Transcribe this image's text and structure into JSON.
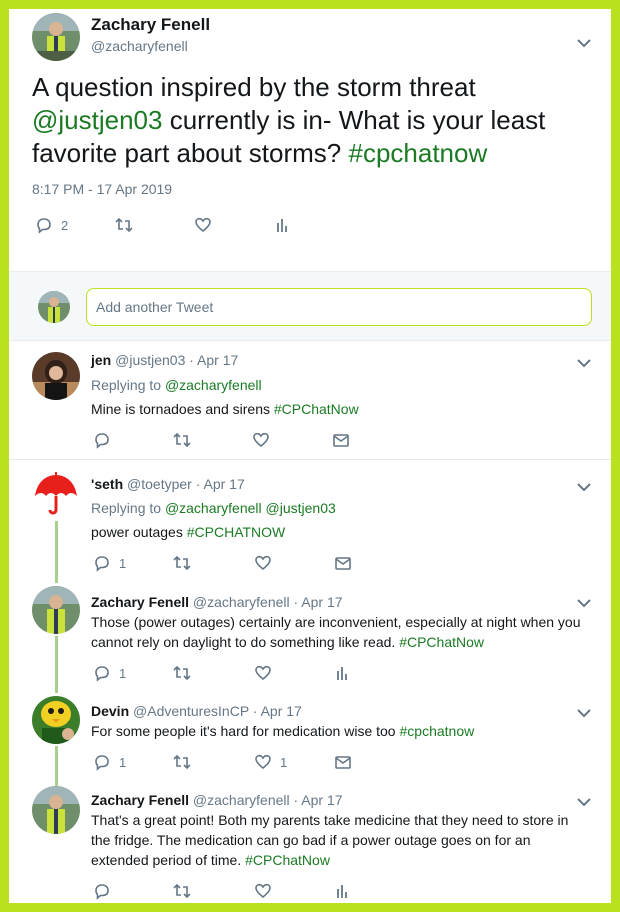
{
  "main_tweet": {
    "author_name": "Zachary Fenell",
    "author_handle": "@zacharyfenell",
    "text_part1": "A question inspired by the storm threat ",
    "mention": "@justjen03",
    "text_part2": " currently is in- What is your least favorite part about storms?  ",
    "hashtag": "#cpchatnow",
    "timestamp": "8:17 PM - 17 Apr 2019",
    "reply_count": "2"
  },
  "composer": {
    "placeholder": "Add another Tweet"
  },
  "replies": [
    {
      "name": "jen",
      "meta": " @justjen03 · Apr 17",
      "replying_label": "Replying to ",
      "replying_to": "@zacharyfenell",
      "text": "Mine is tornadoes and sirens ",
      "hashtag": "#CPChatNow"
    },
    {
      "name": "'seth",
      "meta": " @toetyper · Apr 17",
      "replying_label": "Replying to ",
      "replying_to": "@zacharyfenell @justjen03",
      "text": "power outages ",
      "hashtag": "#CPCHATNOW",
      "reply_count": "1"
    },
    {
      "name": "Zachary Fenell",
      "meta": " @zacharyfenell · Apr 17",
      "text": "Those (power outages) certainly are inconvenient, especially at night when you cannot rely on daylight to do something like read. ",
      "hashtag": "#CPChatNow",
      "reply_count": "1"
    },
    {
      "name": "Devin",
      "meta": " @AdventuresInCP · Apr 17",
      "text": "For some people it's hard for medication wise too ",
      "hashtag": "#cpchatnow",
      "reply_count": "1",
      "like_count": "1"
    },
    {
      "name": "Zachary Fenell",
      "meta": " @zacharyfenell · Apr 17",
      "text": "That's a great point! Both my parents take medicine that they need to store in the fridge. The medication can go bad if a power outage goes on for an extended period of time. ",
      "hashtag": "#CPChatNow"
    }
  ],
  "colors": {
    "frame": "#b9e11e",
    "link": "#1b7a23",
    "thread_line": "#a6d18c",
    "muted": "#657786"
  }
}
